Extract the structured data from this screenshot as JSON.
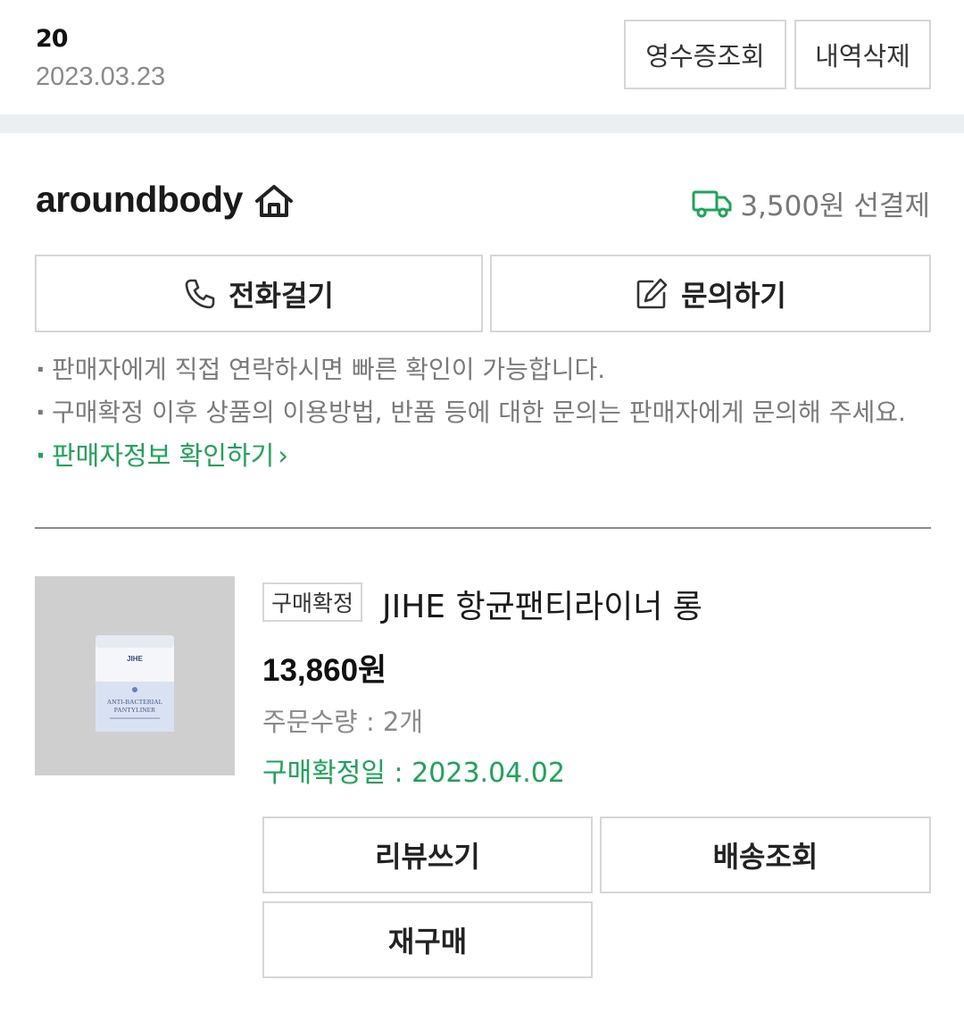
{
  "order": {
    "number_fragment": "20",
    "date": "2023.03.23",
    "receipt_label": "영수증조회",
    "delete_label": "내역삭제"
  },
  "seller": {
    "name": "aroundbody",
    "shipping_text": "3,500원 선결제",
    "call_label": "전화걸기",
    "inquiry_label": "문의하기",
    "notes": [
      "판매자에게 직접 연락하시면 빠른 확인이 가능합니다.",
      "구매확정 이후 상품의 이용방법, 반품 등에 대한 문의는 판매자에게 문의해 주세요."
    ],
    "info_link": "판매자정보 확인하기"
  },
  "product": {
    "status": "구매확정",
    "name": "JIHE 항균팬티라이너 롱",
    "price": "13,860원",
    "quantity": "주문수량 : 2개",
    "confirm_date": "구매확정일 : 2023.04.02",
    "package_brand": "JIHE",
    "package_text_1": "ANTI-BACTERIAL",
    "package_text_2": "PANTYLINER"
  },
  "actions": {
    "review_label": "리뷰쓰기",
    "track_label": "배송조회",
    "rebuy_label": "재구매"
  },
  "colors": {
    "accent_green": "#19a657",
    "border": "#d6d6d6",
    "band": "#eceff2"
  }
}
